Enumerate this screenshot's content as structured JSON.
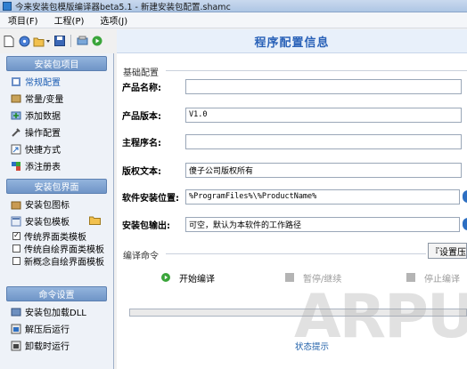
{
  "window": {
    "title": "今来安装包模版编译器beta5.1 - 新建安装包配置.shamc"
  },
  "menu": [
    "项目(F)",
    "工程(P)",
    "选项(J)"
  ],
  "sidebar": {
    "sections": [
      {
        "title": "安装包项目",
        "items": [
          {
            "label": "常规配置",
            "icon": "settings-icon",
            "active": true
          },
          {
            "label": "常量/变量",
            "icon": "variable-icon"
          },
          {
            "label": "添加数据",
            "icon": "add-data-icon"
          },
          {
            "label": "操作配置",
            "icon": "operation-icon"
          },
          {
            "label": "快捷方式",
            "icon": "shortcut-icon"
          },
          {
            "label": "添注册表",
            "icon": "registry-icon"
          }
        ]
      },
      {
        "title": "安装包界面",
        "items": [
          {
            "label": "安装包图标",
            "icon": "package-icon"
          },
          {
            "label": "安装包模板",
            "icon": "template-icon"
          }
        ],
        "templates": [
          {
            "label": "传统界面类模板",
            "checked": true
          },
          {
            "label": "传统自绘界面类模板",
            "checked": false
          },
          {
            "label": "新概念自绘界面模板",
            "checked": false
          }
        ]
      },
      {
        "title": "命令设置",
        "items": [
          {
            "label": "安装包加载DLL",
            "icon": "dll-icon"
          },
          {
            "label": "解压后运行",
            "icon": "run-after-extract-icon"
          },
          {
            "label": "卸载时运行",
            "icon": "run-on-uninstall-icon"
          }
        ]
      }
    ]
  },
  "main": {
    "title": "程序配置信息",
    "basic_group": "基础配置",
    "fields": [
      {
        "label": "产品名称:",
        "value": ""
      },
      {
        "label": "产品版本:",
        "value": "V1.0"
      },
      {
        "label": "主程序名:",
        "value": ""
      },
      {
        "label": "版权文本:",
        "value": "傻子公司版权所有"
      },
      {
        "label": "软件安装位置:",
        "value": "%ProgramFiles%\\%ProductName%"
      },
      {
        "label": "安装包输出:",
        "value": "可空，默认为本软件的工作路径"
      }
    ],
    "compile_group": "编译命令",
    "settings_button": "『设置压缩",
    "buttons": [
      {
        "label": "开始编译",
        "enabled": true
      },
      {
        "label": "暂停/继续",
        "enabled": false
      },
      {
        "label": "停止编译",
        "enabled": false
      }
    ],
    "progress": 0,
    "status": "状态提示"
  },
  "watermark": "ARPUN",
  "colors": {
    "accent": "#2a62b8",
    "section_header": "#7c9fce",
    "disabled": "#9a9a9a"
  }
}
